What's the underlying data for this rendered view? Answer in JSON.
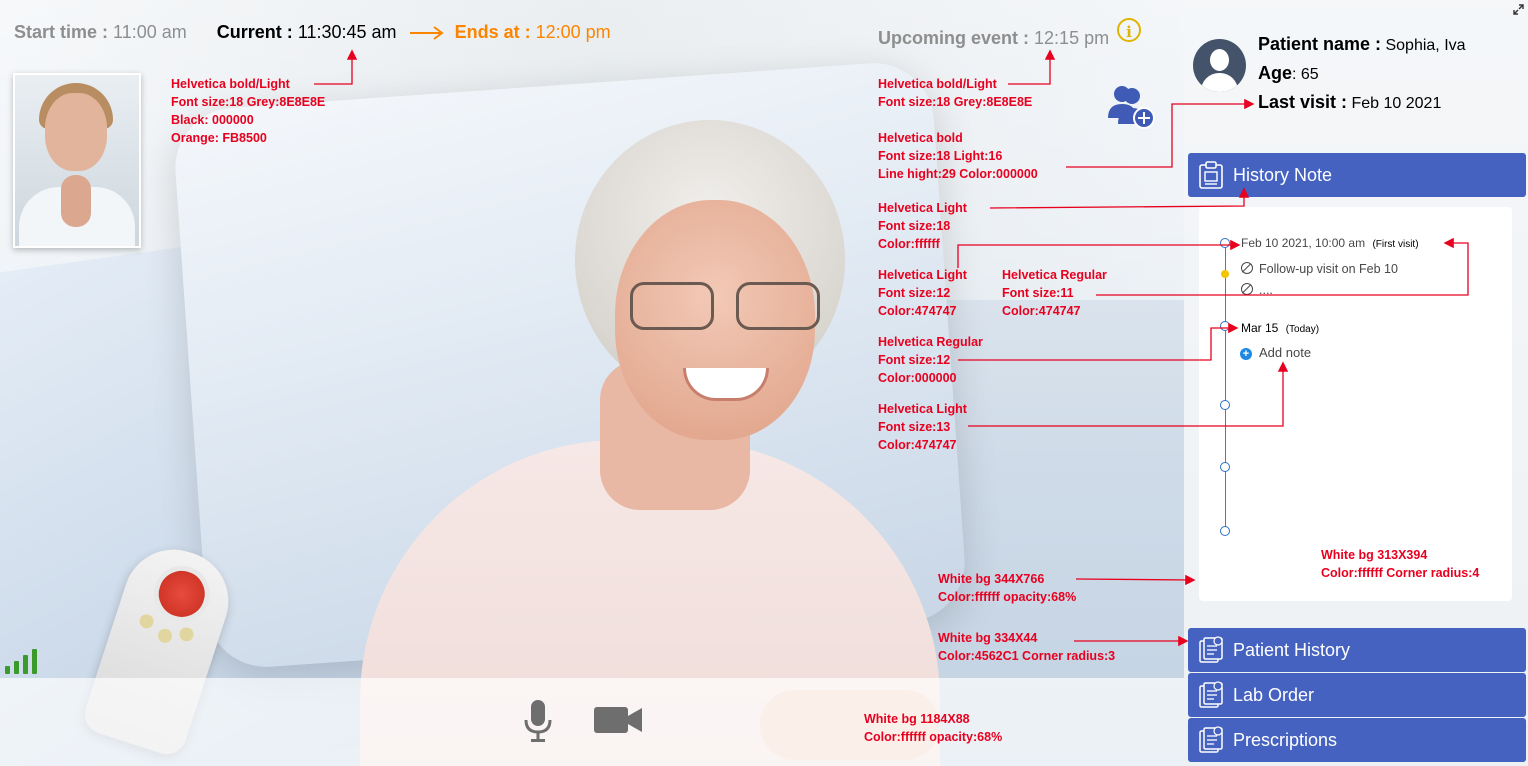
{
  "topbar": {
    "start_label": "Start time :",
    "start_value": "11:00 am",
    "current_label": "Current :",
    "current_value": "11:30:45 am",
    "ends_label": "Ends at :",
    "ends_value": "12:00 pm",
    "upcoming_label": "Upcoming event :",
    "upcoming_value": "12:15 pm",
    "info_glyph": "i"
  },
  "patient": {
    "name_label": "Patient name :",
    "name_value": "Sophia, Iva",
    "age_label": "Age",
    "age_value": ": 65",
    "last_visit_label": "Last visit :",
    "last_visit_value": "Feb 10 2021"
  },
  "nav": {
    "history_note": "History Note",
    "patient_history": "Patient History",
    "lab_order": "Lab Order",
    "prescriptions": "Prescriptions"
  },
  "timeline": {
    "entry1_date": "Feb 10 2021, 10:00 am",
    "entry1_tag": "(First visit)",
    "entry1_note": "Follow-up visit on Feb 10",
    "entry1_more": "....",
    "entry2_date": "Mar 15",
    "entry2_tag": "(Today)",
    "add_note": "Add note"
  },
  "annotations": {
    "a1": [
      "Helvetica bold/Light",
      "Font size:18 Grey:8E8E8E",
      "Black: 000000",
      "Orange: FB8500"
    ],
    "a2": [
      "Helvetica bold/Light",
      "Font size:18 Grey:8E8E8E"
    ],
    "a3": [
      "Helvetica bold",
      "Font size:18  Light:16",
      "Line hight:29  Color:000000"
    ],
    "a4": [
      "Helvetica Light",
      "Font size:18",
      "Color:ffffff"
    ],
    "a5": [
      "Helvetica Light",
      "Font size:12",
      "Color:474747"
    ],
    "a6": [
      "Helvetica Regular",
      "Font size:11",
      "Color:474747"
    ],
    "a7": [
      "Helvetica Regular",
      "Font size:12",
      "Color:000000"
    ],
    "a8": [
      "Helvetica Light",
      "Font size:13",
      "Color:474747"
    ],
    "a9": [
      "White bg 344X766",
      "Color:ffffff opacity:68%"
    ],
    "a10": [
      "White bg 313X394",
      "Color:ffffff Corner radius:4"
    ],
    "a11": [
      "White bg 334X44",
      "Color:4562C1 Corner radius:3"
    ],
    "a12": [
      "White bg 1184X88",
      "Color:ffffff opacity:68%"
    ]
  },
  "icons": {
    "info": "info-icon",
    "add_user": "add-user-icon",
    "mic": "microphone-icon",
    "camera": "video-camera-icon",
    "signal": "signal-strength-icon",
    "expand": "expand-icon",
    "avatar": "avatar-icon",
    "clipboard": "clipboard-icon",
    "document": "document-icon"
  },
  "colors": {
    "grey": "#8E8E8E",
    "black": "#000000",
    "orange": "#FB8500",
    "nav_blue": "#4562C1",
    "note_text": "#474747",
    "annotation_red": "#E8001F"
  }
}
